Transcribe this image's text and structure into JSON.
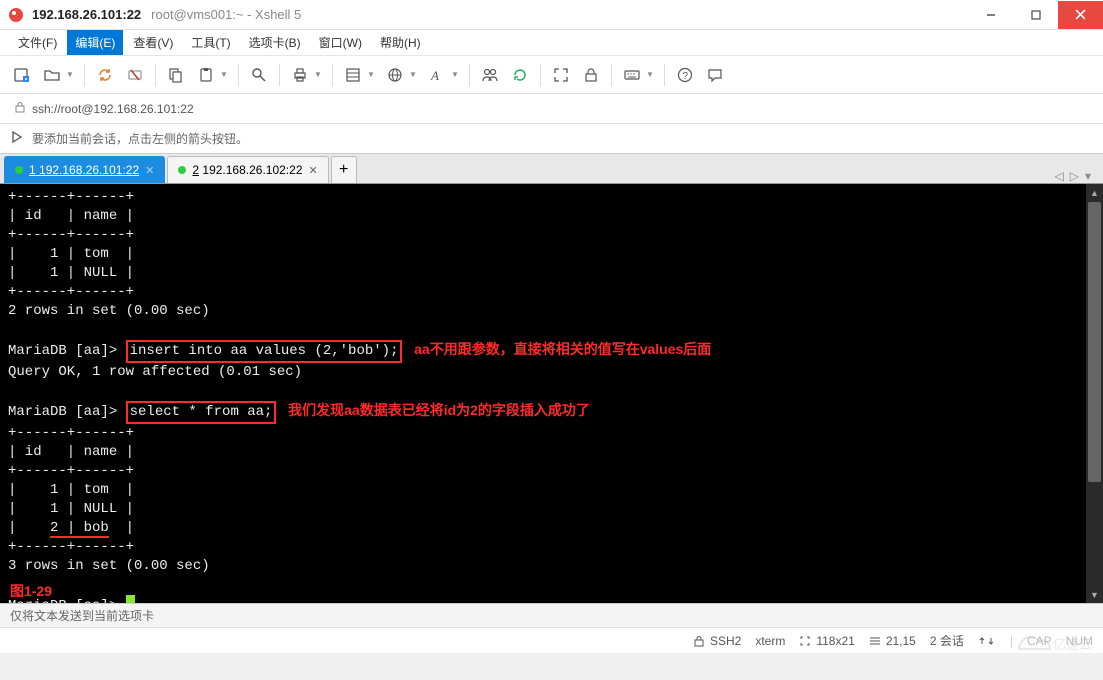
{
  "title": {
    "main": "192.168.26.101:22",
    "sub": "root@vms001:~ - Xshell 5"
  },
  "menu": {
    "file": "文件(F)",
    "edit": "编辑(E)",
    "view": "查看(V)",
    "tools": "工具(T)",
    "tabs": "选项卡(B)",
    "window": "窗口(W)",
    "help": "帮助(H)"
  },
  "address": "ssh://root@192.168.26.101:22",
  "infobar": "要添加当前会话，点击左侧的箭头按钮。",
  "tabs": [
    {
      "index": "1",
      "label": "192.168.26.101:22"
    },
    {
      "index": "2",
      "label": "192.168.26.102:22"
    }
  ],
  "terminal": {
    "hdr_sep": "+------+------+",
    "hdr_row": "| id   | name |",
    "row_tom": "|    1 | tom  |",
    "row_null": "|    1 | NULL |",
    "row_bob_a": "|    ",
    "row_bob_b": "2 | bob",
    "row_bob_c": "  |",
    "rows2": "2 rows in set (0.00 sec)",
    "rows3": "3 rows in set (0.00 sec)",
    "prompt": "MariaDB [aa]> ",
    "sql_insert": "insert into aa values (2,'bob');",
    "anno1": "   aa不用跟参数，直接将相关的值写在values后面",
    "queryok": "Query OK, 1 row affected (0.01 sec)",
    "sql_select": "select * from aa;",
    "anno2": "   我们发现aa数据表已经将id为2的字段插入成功了",
    "figlabel": "图1-29"
  },
  "status": {
    "hint": "仅将文本发送到当前选项卡",
    "proto": "SSH2",
    "term": "xterm",
    "size": "118x21",
    "pos": "21,15",
    "sessions": "2 会话",
    "caps": "CAP",
    "nums": "NUM"
  },
  "watermark": "亿速云"
}
